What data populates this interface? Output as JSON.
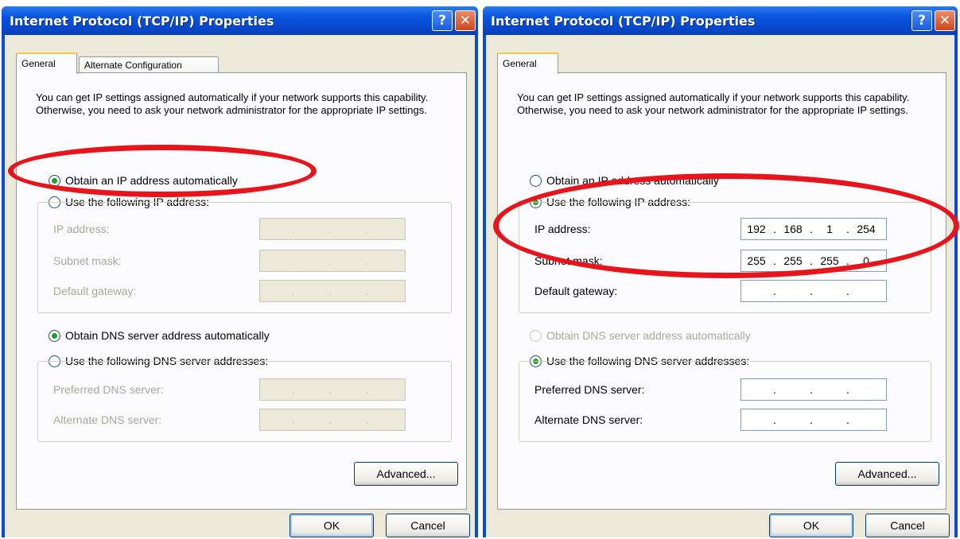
{
  "left": {
    "title": "Internet Protocol (TCP/IP) Properties",
    "help_icon": "?",
    "close_icon": "✕",
    "tabs": [
      "General",
      "Alternate Configuration"
    ],
    "description": "You can get IP settings assigned automatically if your network supports this capability. Otherwise, you need to ask your network administrator for the appropriate IP settings.",
    "radio_auto_ip": "Obtain an IP address automatically",
    "radio_static_ip": "Use the following IP address:",
    "ip_label": "IP address:",
    "subnet_label": "Subnet mask:",
    "gateway_label": "Default gateway:",
    "radio_auto_dns": "Obtain DNS server address automatically",
    "radio_static_dns": "Use the following DNS server addresses:",
    "pref_dns_label": "Preferred DNS server:",
    "alt_dns_label": "Alternate DNS server:",
    "advanced": "Advanced...",
    "ok": "OK",
    "cancel": "Cancel"
  },
  "right": {
    "title": "Internet Protocol (TCP/IP) Properties",
    "help_icon": "?",
    "close_icon": "✕",
    "tabs": [
      "General"
    ],
    "description": "You can get IP settings assigned automatically if your network supports this capability. Otherwise, you need to ask your network administrator for the appropriate IP settings.",
    "radio_auto_ip": "Obtain an IP address automatically",
    "radio_static_ip": "Use the following IP address:",
    "ip_label": "IP address:",
    "ip_value": [
      "192",
      "168",
      "1",
      "254"
    ],
    "subnet_label": "Subnet mask:",
    "subnet_value": [
      "255",
      "255",
      "255",
      "0"
    ],
    "gateway_label": "Default gateway:",
    "radio_auto_dns": "Obtain DNS server address automatically",
    "radio_static_dns": "Use the following DNS server addresses:",
    "pref_dns_label": "Preferred DNS server:",
    "alt_dns_label": "Alternate DNS server:",
    "advanced": "Advanced...",
    "ok": "OK",
    "cancel": "Cancel"
  },
  "ip_dot": ".",
  "colors": {
    "highlight_ellipse": "#e8141c",
    "titlebar": "#0a55e0",
    "dialog_face": "#ece9d8",
    "radio_selected": "#21a121"
  }
}
